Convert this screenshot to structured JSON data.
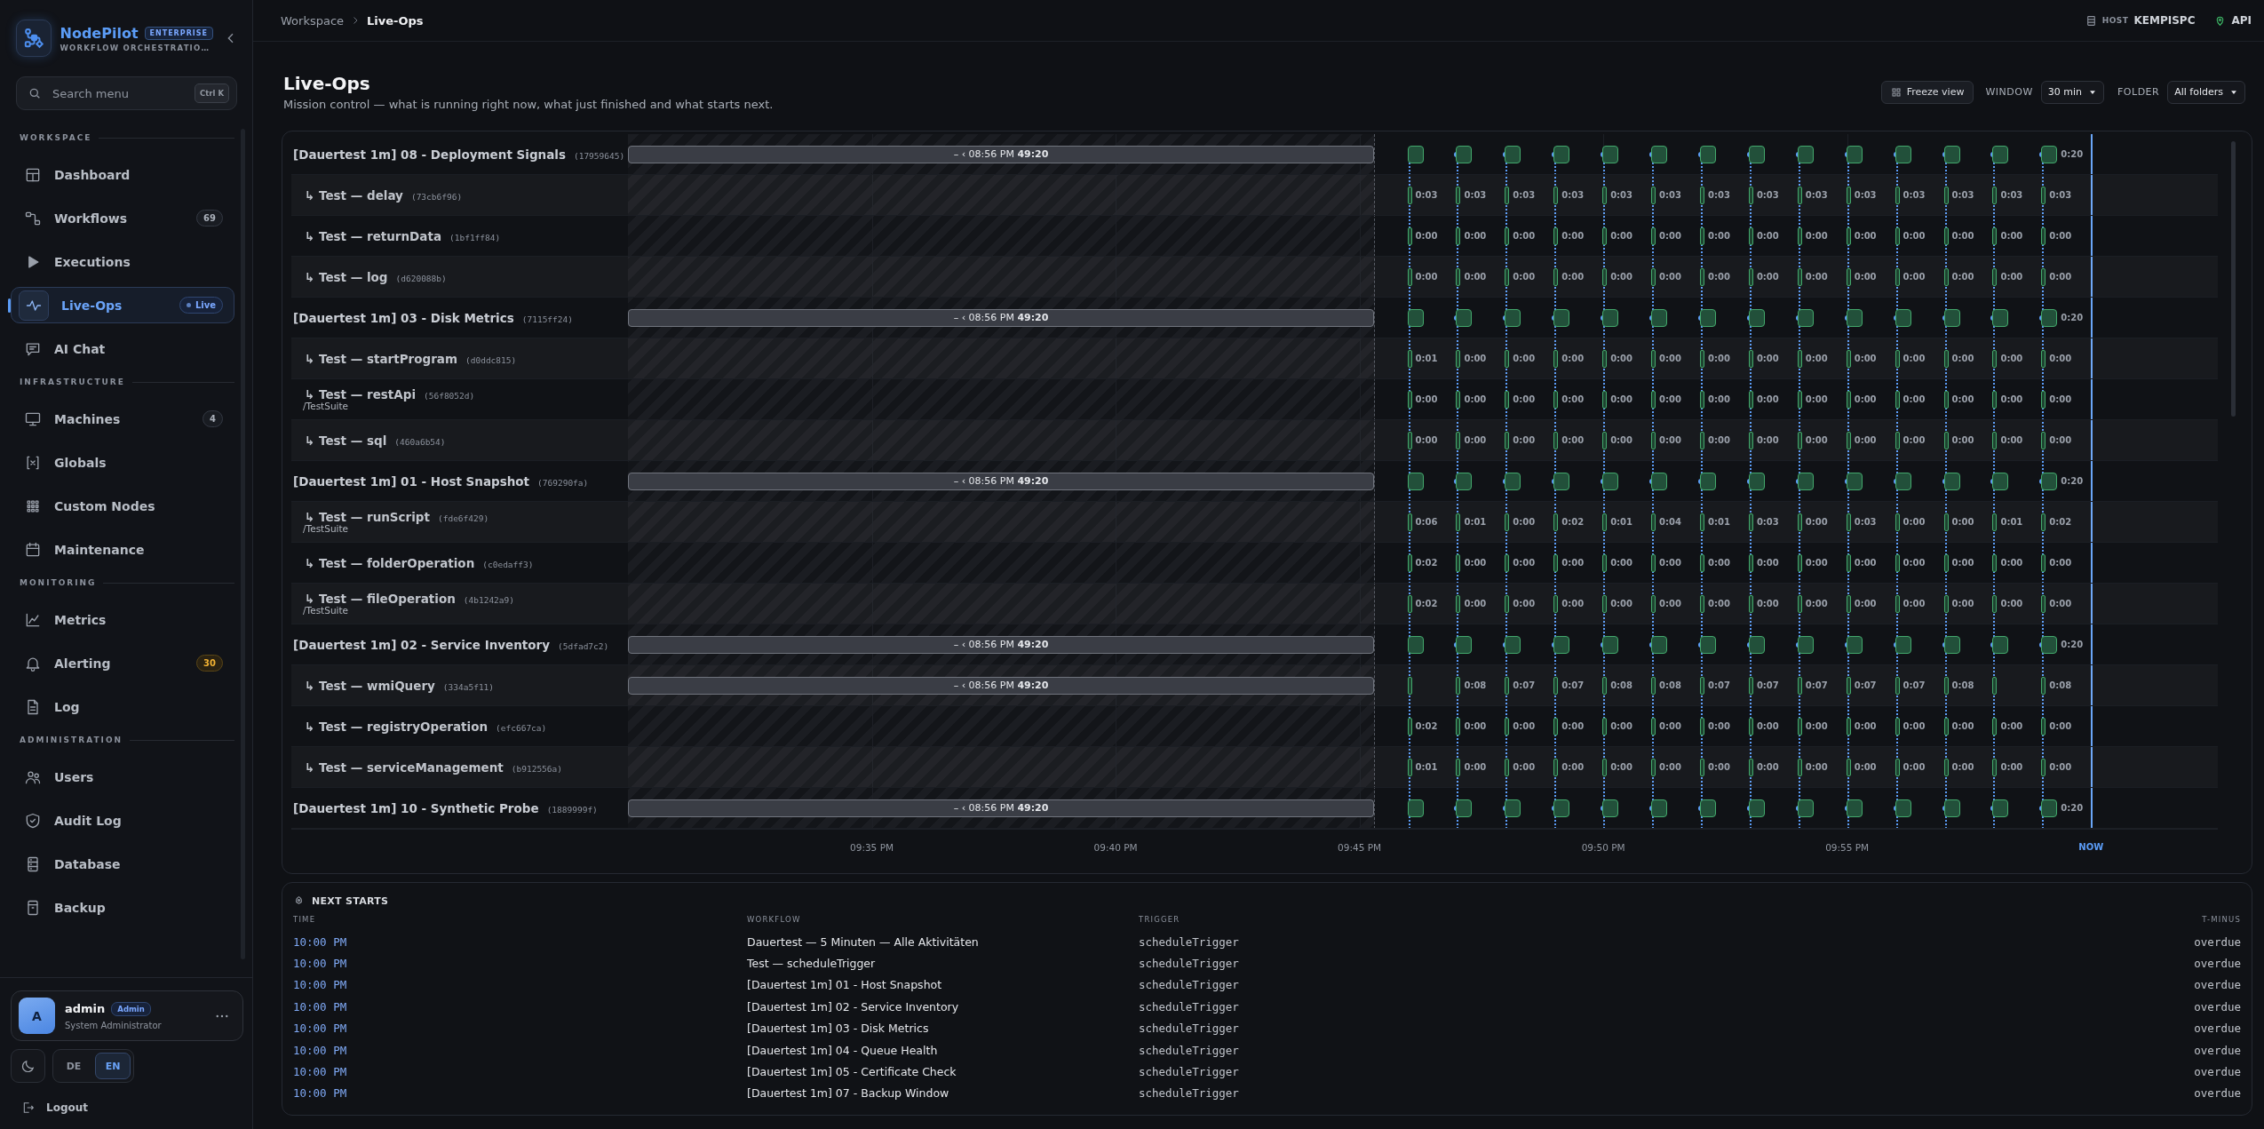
{
  "sidebar": {
    "brand": {
      "name": "NodePilot",
      "edition": "ENTERPRISE",
      "tagline": "WORKFLOW ORCHESTRATIO…"
    },
    "search": {
      "placeholder": "Search menu",
      "shortcut": "Ctrl K"
    },
    "sections": [
      {
        "title": "WORKSPACE",
        "items": [
          {
            "label": "Dashboard",
            "selected": false
          },
          {
            "label": "Workflows",
            "selected": false,
            "badge": {
              "text": "69",
              "kind": "count"
            }
          },
          {
            "label": "Executions",
            "selected": false
          },
          {
            "label": "Live-Ops",
            "selected": true,
            "badge": {
              "text": "Live",
              "kind": "live"
            }
          },
          {
            "label": "AI Chat",
            "selected": false
          }
        ]
      },
      {
        "title": "INFRASTRUCTURE",
        "items": [
          {
            "label": "Machines",
            "selected": false,
            "badge": {
              "text": "4",
              "kind": "count"
            }
          },
          {
            "label": "Globals",
            "selected": false
          },
          {
            "label": "Custom Nodes",
            "selected": false
          },
          {
            "label": "Maintenance",
            "selected": false
          }
        ]
      },
      {
        "title": "MONITORING",
        "items": [
          {
            "label": "Metrics",
            "selected": false
          },
          {
            "label": "Alerting",
            "selected": false,
            "badge": {
              "text": "30",
              "kind": "warning"
            }
          },
          {
            "label": "Log",
            "selected": false
          }
        ]
      },
      {
        "title": "ADMINISTRATION",
        "items": [
          {
            "label": "Users",
            "selected": false
          },
          {
            "label": "Audit Log",
            "selected": false
          },
          {
            "label": "Database",
            "selected": false
          },
          {
            "label": "Backup",
            "selected": false
          }
        ]
      }
    ],
    "user": {
      "initial": "A",
      "name": "admin",
      "role": "Admin",
      "title": "System Administrator"
    },
    "languages": [
      {
        "label": "DE",
        "selected": false
      },
      {
        "label": "EN",
        "selected": true
      }
    ],
    "logout": "Logout"
  },
  "topbar": {
    "breadcrumb": [
      "Workspace",
      "Live-Ops"
    ],
    "host_label": "HOST",
    "host": "KEMPISPC",
    "api": "API"
  },
  "page": {
    "title": "Live-Ops",
    "subtitle": "Mission control — what is running right now, what just finished and what starts next.",
    "freeze": "Freeze view",
    "window": {
      "label": "WINDOW",
      "value": "30 min"
    },
    "folder": {
      "label": "FOLDER",
      "value": "All folders"
    }
  },
  "timeline": {
    "rows": [
      {
        "kind": "workflow",
        "name": "[Dauertest 1m] 08 - Deployment Signals",
        "id": "(17959645)",
        "bar": "– ‹ 08:56 PM **49:20**",
        "runs": [
          {
            "kind": "block"
          },
          {
            "kind": "block"
          },
          {
            "kind": "block"
          },
          {
            "kind": "block"
          },
          {
            "kind": "block"
          },
          {
            "kind": "block"
          },
          {
            "kind": "block"
          },
          {
            "kind": "block"
          },
          {
            "kind": "block"
          },
          {
            "kind": "block"
          },
          {
            "kind": "block"
          },
          {
            "kind": "block"
          },
          {
            "kind": "block"
          },
          {
            "kind": "block",
            "duration": "0:20"
          }
        ]
      },
      {
        "kind": "step",
        "name": "↳ Test — delay",
        "id": "(73cb6f96)",
        "runs": [
          {
            "kind": "bar",
            "duration": "0:03"
          },
          {
            "kind": "bar",
            "duration": "0:03"
          },
          {
            "kind": "bar",
            "duration": "0:03"
          },
          {
            "kind": "bar",
            "duration": "0:03"
          },
          {
            "kind": "bar",
            "duration": "0:03"
          },
          {
            "kind": "bar",
            "duration": "0:03"
          },
          {
            "kind": "bar",
            "duration": "0:03"
          },
          {
            "kind": "bar",
            "duration": "0:03"
          },
          {
            "kind": "bar",
            "duration": "0:03"
          },
          {
            "kind": "bar",
            "duration": "0:03"
          },
          {
            "kind": "bar",
            "duration": "0:03"
          },
          {
            "kind": "bar",
            "duration": "0:03"
          },
          {
            "kind": "bar",
            "duration": "0:03"
          },
          {
            "kind": "bar",
            "duration": "0:03"
          }
        ]
      },
      {
        "kind": "step",
        "name": "↳ Test — returnData",
        "id": "(1bf1ff84)",
        "runs": [
          {
            "kind": "bar",
            "duration": "0:00"
          },
          {
            "kind": "bar",
            "duration": "0:00"
          },
          {
            "kind": "bar",
            "duration": "0:00"
          },
          {
            "kind": "bar",
            "duration": "0:00"
          },
          {
            "kind": "bar",
            "duration": "0:00"
          },
          {
            "kind": "bar",
            "duration": "0:00"
          },
          {
            "kind": "bar",
            "duration": "0:00"
          },
          {
            "kind": "bar",
            "duration": "0:00"
          },
          {
            "kind": "bar",
            "duration": "0:00"
          },
          {
            "kind": "bar",
            "duration": "0:00"
          },
          {
            "kind": "bar",
            "duration": "0:00"
          },
          {
            "kind": "bar",
            "duration": "0:00"
          },
          {
            "kind": "bar",
            "duration": "0:00"
          },
          {
            "kind": "bar",
            "duration": "0:00"
          }
        ]
      },
      {
        "kind": "step",
        "name": "↳ Test — log",
        "id": "(d620088b)",
        "runs": [
          {
            "kind": "bar",
            "duration": "0:00"
          },
          {
            "kind": "bar",
            "duration": "0:00"
          },
          {
            "kind": "bar",
            "duration": "0:00"
          },
          {
            "kind": "bar",
            "duration": "0:00"
          },
          {
            "kind": "bar",
            "duration": "0:00"
          },
          {
            "kind": "bar",
            "duration": "0:00"
          },
          {
            "kind": "bar",
            "duration": "0:00"
          },
          {
            "kind": "bar",
            "duration": "0:00"
          },
          {
            "kind": "bar",
            "duration": "0:00"
          },
          {
            "kind": "bar",
            "duration": "0:00"
          },
          {
            "kind": "bar",
            "duration": "0:00"
          },
          {
            "kind": "bar",
            "duration": "0:00"
          },
          {
            "kind": "bar",
            "duration": "0:00"
          },
          {
            "kind": "bar",
            "duration": "0:00"
          }
        ]
      },
      {
        "kind": "workflow",
        "name": "[Dauertest 1m] 03 - Disk Metrics",
        "id": "(7115ff24)",
        "bar": "– ‹ 08:56 PM **49:20**",
        "runs": [
          {
            "kind": "block"
          },
          {
            "kind": "block"
          },
          {
            "kind": "block"
          },
          {
            "kind": "block"
          },
          {
            "kind": "block"
          },
          {
            "kind": "block"
          },
          {
            "kind": "block"
          },
          {
            "kind": "block"
          },
          {
            "kind": "block"
          },
          {
            "kind": "block"
          },
          {
            "kind": "block"
          },
          {
            "kind": "block"
          },
          {
            "kind": "block"
          },
          {
            "kind": "block",
            "duration": "0:20"
          }
        ]
      },
      {
        "kind": "step",
        "name": "↳ Test — startProgram",
        "id": "(d0ddc815)",
        "runs": [
          {
            "kind": "bar",
            "duration": "0:01"
          },
          {
            "kind": "bar",
            "duration": "0:00"
          },
          {
            "kind": "bar",
            "duration": "0:00"
          },
          {
            "kind": "bar",
            "duration": "0:00"
          },
          {
            "kind": "bar",
            "duration": "0:00"
          },
          {
            "kind": "bar",
            "duration": "0:00"
          },
          {
            "kind": "bar",
            "duration": "0:00"
          },
          {
            "kind": "bar",
            "duration": "0:00"
          },
          {
            "kind": "bar",
            "duration": "0:00"
          },
          {
            "kind": "bar",
            "duration": "0:00"
          },
          {
            "kind": "bar",
            "duration": "0:00"
          },
          {
            "kind": "bar",
            "duration": "0:00"
          },
          {
            "kind": "bar",
            "duration": "0:00"
          },
          {
            "kind": "bar",
            "duration": "0:00"
          }
        ]
      },
      {
        "kind": "step",
        "name": "↳ Test — restApi",
        "id": "(56f8052d)",
        "path": "/TestSuite",
        "runs": [
          {
            "kind": "bar",
            "duration": "0:00"
          },
          {
            "kind": "bar",
            "duration": "0:00"
          },
          {
            "kind": "bar",
            "duration": "0:00"
          },
          {
            "kind": "bar",
            "duration": "0:00"
          },
          {
            "kind": "bar",
            "duration": "0:00"
          },
          {
            "kind": "bar",
            "duration": "0:00"
          },
          {
            "kind": "bar",
            "duration": "0:00"
          },
          {
            "kind": "bar",
            "duration": "0:00"
          },
          {
            "kind": "bar",
            "duration": "0:00"
          },
          {
            "kind": "bar",
            "duration": "0:00"
          },
          {
            "kind": "bar",
            "duration": "0:00"
          },
          {
            "kind": "bar",
            "duration": "0:00"
          },
          {
            "kind": "bar",
            "duration": "0:00"
          },
          {
            "kind": "bar",
            "duration": "0:00"
          }
        ]
      },
      {
        "kind": "step",
        "name": "↳ Test — sql",
        "id": "(460a6b54)",
        "runs": [
          {
            "kind": "bar",
            "duration": "0:00"
          },
          {
            "kind": "bar",
            "duration": "0:00"
          },
          {
            "kind": "bar",
            "duration": "0:00"
          },
          {
            "kind": "bar",
            "duration": "0:00"
          },
          {
            "kind": "bar",
            "duration": "0:00"
          },
          {
            "kind": "bar",
            "duration": "0:00"
          },
          {
            "kind": "bar",
            "duration": "0:00"
          },
          {
            "kind": "bar",
            "duration": "0:00"
          },
          {
            "kind": "bar",
            "duration": "0:00"
          },
          {
            "kind": "bar",
            "duration": "0:00"
          },
          {
            "kind": "bar",
            "duration": "0:00"
          },
          {
            "kind": "bar",
            "duration": "0:00"
          },
          {
            "kind": "bar",
            "duration": "0:00"
          },
          {
            "kind": "bar",
            "duration": "0:00"
          }
        ]
      },
      {
        "kind": "workflow",
        "name": "[Dauertest 1m] 01 - Host Snapshot",
        "id": "(769290fa)",
        "bar": "– ‹ 08:56 PM **49:20**",
        "runs": [
          {
            "kind": "block"
          },
          {
            "kind": "block"
          },
          {
            "kind": "block"
          },
          {
            "kind": "block"
          },
          {
            "kind": "block"
          },
          {
            "kind": "block"
          },
          {
            "kind": "block"
          },
          {
            "kind": "block"
          },
          {
            "kind": "block"
          },
          {
            "kind": "block"
          },
          {
            "kind": "block"
          },
          {
            "kind": "block"
          },
          {
            "kind": "block"
          },
          {
            "kind": "block",
            "duration": "0:20"
          }
        ]
      },
      {
        "kind": "step",
        "name": "↳ Test — runScript",
        "id": "(fde6f429)",
        "path": "/TestSuite",
        "runs": [
          {
            "kind": "bar",
            "duration": "0:06"
          },
          {
            "kind": "bar",
            "duration": "0:01"
          },
          {
            "kind": "bar",
            "duration": "0:00"
          },
          {
            "kind": "bar",
            "duration": "0:02"
          },
          {
            "kind": "bar",
            "duration": "0:01"
          },
          {
            "kind": "bar",
            "duration": "0:04"
          },
          {
            "kind": "bar",
            "duration": "0:01"
          },
          {
            "kind": "bar",
            "duration": "0:03"
          },
          {
            "kind": "bar",
            "duration": "0:00"
          },
          {
            "kind": "bar",
            "duration": "0:03"
          },
          {
            "kind": "bar",
            "duration": "0:00"
          },
          {
            "kind": "bar",
            "duration": "0:00"
          },
          {
            "kind": "bar",
            "duration": "0:01"
          },
          {
            "kind": "bar",
            "duration": "0:02"
          }
        ]
      },
      {
        "kind": "step",
        "name": "↳ Test — folderOperation",
        "id": "(c0edaff3)",
        "runs": [
          {
            "kind": "bar",
            "duration": "0:02"
          },
          {
            "kind": "bar",
            "duration": "0:00"
          },
          {
            "kind": "bar",
            "duration": "0:00"
          },
          {
            "kind": "bar",
            "duration": "0:00"
          },
          {
            "kind": "bar",
            "duration": "0:00"
          },
          {
            "kind": "bar",
            "duration": "0:00"
          },
          {
            "kind": "bar",
            "duration": "0:00"
          },
          {
            "kind": "bar",
            "duration": "0:00"
          },
          {
            "kind": "bar",
            "duration": "0:00"
          },
          {
            "kind": "bar",
            "duration": "0:00"
          },
          {
            "kind": "bar",
            "duration": "0:00"
          },
          {
            "kind": "bar",
            "duration": "0:00"
          },
          {
            "kind": "bar",
            "duration": "0:00"
          },
          {
            "kind": "bar",
            "duration": "0:00"
          }
        ]
      },
      {
        "kind": "step",
        "name": "↳ Test — fileOperation",
        "id": "(4b1242a9)",
        "path": "/TestSuite",
        "runs": [
          {
            "kind": "bar",
            "duration": "0:02"
          },
          {
            "kind": "bar",
            "duration": "0:00"
          },
          {
            "kind": "bar",
            "duration": "0:00"
          },
          {
            "kind": "bar",
            "duration": "0:00"
          },
          {
            "kind": "bar",
            "duration": "0:00"
          },
          {
            "kind": "bar",
            "duration": "0:00"
          },
          {
            "kind": "bar",
            "duration": "0:00"
          },
          {
            "kind": "bar",
            "duration": "0:00"
          },
          {
            "kind": "bar",
            "duration": "0:00"
          },
          {
            "kind": "bar",
            "duration": "0:00"
          },
          {
            "kind": "bar",
            "duration": "0:00"
          },
          {
            "kind": "bar",
            "duration": "0:00"
          },
          {
            "kind": "bar",
            "duration": "0:00"
          },
          {
            "kind": "bar",
            "duration": "0:00"
          }
        ]
      },
      {
        "kind": "workflow",
        "name": "[Dauertest 1m] 02 - Service Inventory",
        "id": "(5dfad7c2)",
        "bar": "– ‹ 08:56 PM **49:20**",
        "runs": [
          {
            "kind": "block"
          },
          {
            "kind": "block"
          },
          {
            "kind": "block"
          },
          {
            "kind": "block"
          },
          {
            "kind": "block"
          },
          {
            "kind": "block"
          },
          {
            "kind": "block"
          },
          {
            "kind": "block"
          },
          {
            "kind": "block"
          },
          {
            "kind": "block"
          },
          {
            "kind": "block"
          },
          {
            "kind": "block"
          },
          {
            "kind": "block"
          },
          {
            "kind": "block",
            "duration": "0:20"
          }
        ]
      },
      {
        "kind": "step",
        "name": "↳ Test — wmiQuery",
        "id": "(334a5f11)",
        "bar": "– ‹ 08:56 PM **49:20**",
        "runs": [
          {
            "kind": "bar"
          },
          {
            "kind": "bar",
            "duration": "0:08"
          },
          {
            "kind": "bar",
            "duration": "0:07"
          },
          {
            "kind": "bar",
            "duration": "0:07"
          },
          {
            "kind": "bar",
            "duration": "0:08"
          },
          {
            "kind": "bar",
            "duration": "0:08"
          },
          {
            "kind": "bar",
            "duration": "0:07"
          },
          {
            "kind": "bar",
            "duration": "0:07"
          },
          {
            "kind": "bar",
            "duration": "0:07"
          },
          {
            "kind": "bar",
            "duration": "0:07"
          },
          {
            "kind": "bar",
            "duration": "0:07"
          },
          {
            "kind": "bar",
            "duration": "0:08"
          },
          {
            "kind": "bar"
          },
          {
            "kind": "bar",
            "duration": "0:08"
          }
        ]
      },
      {
        "kind": "step",
        "name": "↳ Test — registryOperation",
        "id": "(efc667ca)",
        "runs": [
          {
            "kind": "bar",
            "duration": "0:02"
          },
          {
            "kind": "bar",
            "duration": "0:00"
          },
          {
            "kind": "bar",
            "duration": "0:00"
          },
          {
            "kind": "bar",
            "duration": "0:00"
          },
          {
            "kind": "bar",
            "duration": "0:00"
          },
          {
            "kind": "bar",
            "duration": "0:00"
          },
          {
            "kind": "bar",
            "duration": "0:00"
          },
          {
            "kind": "bar",
            "duration": "0:00"
          },
          {
            "kind": "bar",
            "duration": "0:00"
          },
          {
            "kind": "bar",
            "duration": "0:00"
          },
          {
            "kind": "bar",
            "duration": "0:00"
          },
          {
            "kind": "bar",
            "duration": "0:00"
          },
          {
            "kind": "bar",
            "duration": "0:00"
          },
          {
            "kind": "bar",
            "duration": "0:00"
          }
        ]
      },
      {
        "kind": "step",
        "name": "↳ Test — serviceManagement",
        "id": "(b912556a)",
        "runs": [
          {
            "kind": "bar",
            "duration": "0:01"
          },
          {
            "kind": "bar",
            "duration": "0:00"
          },
          {
            "kind": "bar",
            "duration": "0:00"
          },
          {
            "kind": "bar",
            "duration": "0:00"
          },
          {
            "kind": "bar",
            "duration": "0:00"
          },
          {
            "kind": "bar",
            "duration": "0:00"
          },
          {
            "kind": "bar",
            "duration": "0:00"
          },
          {
            "kind": "bar",
            "duration": "0:00"
          },
          {
            "kind": "bar",
            "duration": "0:00"
          },
          {
            "kind": "bar",
            "duration": "0:00"
          },
          {
            "kind": "bar",
            "duration": "0:00"
          },
          {
            "kind": "bar",
            "duration": "0:00"
          },
          {
            "kind": "bar",
            "duration": "0:00"
          },
          {
            "kind": "bar",
            "duration": "0:00"
          }
        ]
      },
      {
        "kind": "workflow",
        "name": "[Dauertest 1m] 10 - Synthetic Probe",
        "id": "(1889999f)",
        "bar": "– ‹ 08:56 PM **49:20**",
        "runs": [
          {
            "kind": "block"
          },
          {
            "kind": "block"
          },
          {
            "kind": "block"
          },
          {
            "kind": "block"
          },
          {
            "kind": "block"
          },
          {
            "kind": "block"
          },
          {
            "kind": "block"
          },
          {
            "kind": "block"
          },
          {
            "kind": "block"
          },
          {
            "kind": "block"
          },
          {
            "kind": "block"
          },
          {
            "kind": "block"
          },
          {
            "kind": "block"
          },
          {
            "kind": "block",
            "duration": "0:20"
          }
        ]
      }
    ],
    "axis": [
      {
        "label": "09:35 PM",
        "kind": "time"
      },
      {
        "label": "09:40 PM",
        "kind": "time"
      },
      {
        "label": "09:45 PM",
        "kind": "time"
      },
      {
        "label": "09:50 PM",
        "kind": "time"
      },
      {
        "label": "09:55 PM",
        "kind": "time"
      },
      {
        "label": "NOW",
        "kind": "now"
      }
    ]
  },
  "next_starts": {
    "title": "NEXT STARTS",
    "columns": [
      "TIME",
      "WORKFLOW",
      "TRIGGER",
      "T-MINUS"
    ],
    "rows": [
      {
        "time": "10:00 PM",
        "workflow": "Dauertest — 5 Minuten — Alle Aktivitäten",
        "trigger": "scheduleTrigger",
        "t_minus": "overdue"
      },
      {
        "time": "10:00 PM",
        "workflow": "Test — scheduleTrigger",
        "trigger": "scheduleTrigger",
        "t_minus": "overdue"
      },
      {
        "time": "10:00 PM",
        "workflow": "[Dauertest 1m] 01 - Host Snapshot",
        "trigger": "scheduleTrigger",
        "t_minus": "overdue"
      },
      {
        "time": "10:00 PM",
        "workflow": "[Dauertest 1m] 02 - Service Inventory",
        "trigger": "scheduleTrigger",
        "t_minus": "overdue"
      },
      {
        "time": "10:00 PM",
        "workflow": "[Dauertest 1m] 03 - Disk Metrics",
        "trigger": "scheduleTrigger",
        "t_minus": "overdue"
      },
      {
        "time": "10:00 PM",
        "workflow": "[Dauertest 1m] 04 - Queue Health",
        "trigger": "scheduleTrigger",
        "t_minus": "overdue"
      },
      {
        "time": "10:00 PM",
        "workflow": "[Dauertest 1m] 05 - Certificate Check",
        "trigger": "scheduleTrigger",
        "t_minus": "overdue"
      },
      {
        "time": "10:00 PM",
        "workflow": "[Dauertest 1m] 07 - Backup Window",
        "trigger": "scheduleTrigger",
        "t_minus": "overdue"
      }
    ]
  }
}
